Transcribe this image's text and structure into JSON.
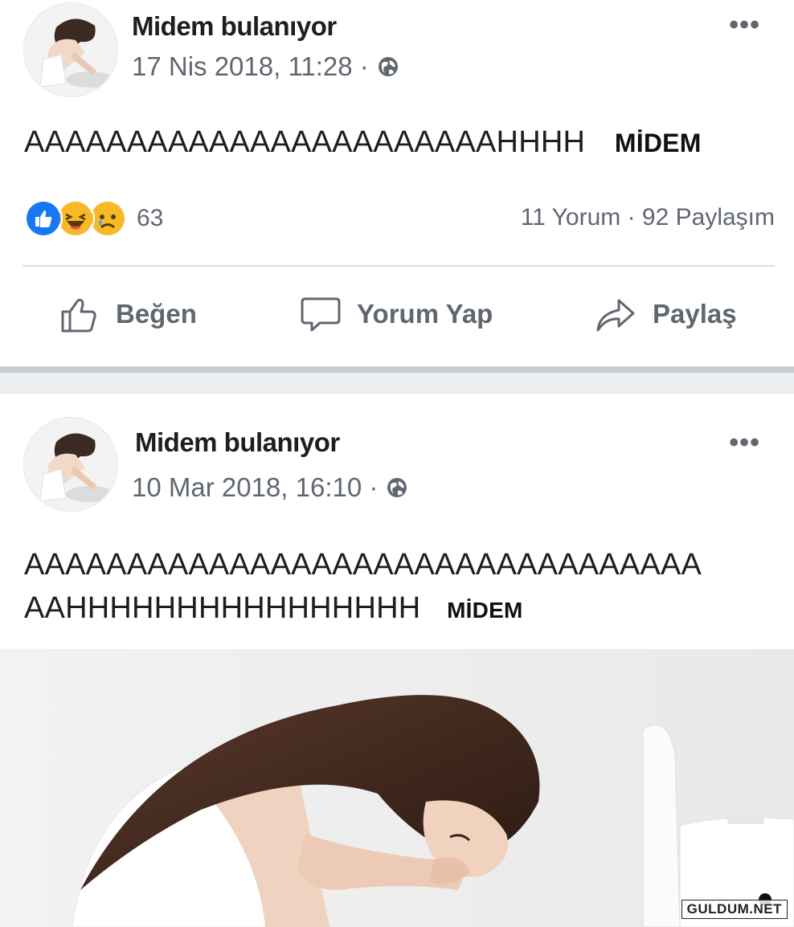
{
  "posts": [
    {
      "author": "Midem bulanıyor",
      "timestamp": "17 Nis 2018, 11:28 ·",
      "text_lines": [
        "AAAAAAAAAAAAAAAAAAAAAAAHHHH"
      ],
      "caption": "MİDEM",
      "reaction_count": "63",
      "reaction_icons": [
        "like-icon",
        "haha-icon",
        "sad-icon"
      ],
      "stats": "11 Yorum · 92 Paylaşım",
      "actions": {
        "like": "Beğen",
        "comment": "Yorum Yap",
        "share": "Paylaş"
      },
      "more_label": "•••"
    },
    {
      "author": "Midem bulanıyor",
      "timestamp": "10 Mar 2018, 16:10 ·",
      "text_lines": [
        "AAAAAAAAAAAAAAAAAAAAAAAAAAAAAAAAA",
        "AAHHHHHHHHHHHHHHHH"
      ],
      "caption": "MİDEM",
      "more_label": "•••"
    }
  ],
  "watermark": "GULDUM.NET",
  "colors": {
    "like_blue": "#1877f2",
    "haha_yellow": "#f7b928",
    "divider": "#ebedf0",
    "meta_gray": "#606770"
  }
}
